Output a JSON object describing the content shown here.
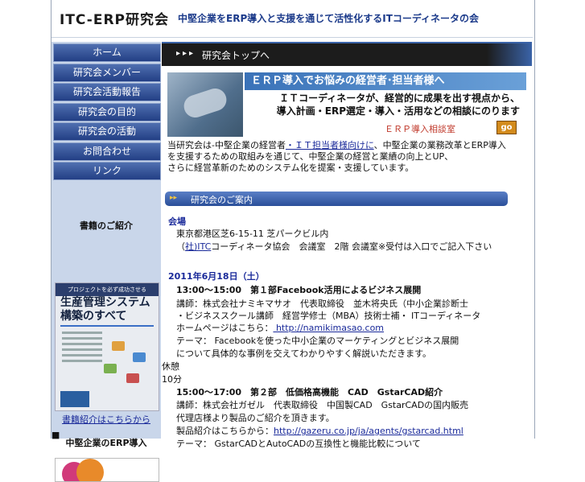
{
  "header": {
    "logo": "ITC-ERP研究会",
    "tagline": "中堅企業をERP導入と支援を通じて活性化するITコーディネータの会"
  },
  "sidebar": {
    "items": [
      {
        "label": "ホーム"
      },
      {
        "label": "研究会メンバー"
      },
      {
        "label": "研究会活動報告"
      },
      {
        "label": "研究会の目的"
      },
      {
        "label": "研究会の活動"
      },
      {
        "label": "お問合わせ"
      },
      {
        "label": "リンク"
      }
    ],
    "book_heading": "書籍のご紹介",
    "book_cover_top": "プロジェクトを必ず成功させる",
    "book_cover_title": "生産管理システム構築のすべて",
    "book_link": "書籍紹介はこちらから",
    "bullet": "■",
    "section2_heading": "中堅企業のERP導入"
  },
  "main": {
    "page_title": "研究会トップへ",
    "banner_headline": "ＥＲＰ導入でお悩みの経営者･担当者様へ",
    "banner_message_1": "ＩＴコーディネータが、経営的に成果を出す視点から、",
    "banner_message_2": "導入計画・ERP選定・導入・活用などの相談にのります",
    "banner_link": "ＥＲＰ導入相談室",
    "go_label": "go",
    "intro_1a": "当研究会は‐中堅企業の経営者",
    "intro_1_link": "・ＩＴ担当者様向けに",
    "intro_1b": "、中堅企業の業務改革とERP導入",
    "intro_2": "を支援するための取組みを通じて、中堅企業の経営と業績の向上とUP、",
    "intro_3": "さらに経営革新のためのシステム化を提案・支援しています。",
    "news_title": "研究会のご案内",
    "arrows": "▸▸▸",
    "news_icon": "▸▸"
  },
  "events": {
    "place_label": "会場",
    "place_address": "東京都港区芝6-15-11 芝パークビル内",
    "place_org_prefix": "（",
    "place_org_link": "社)ITC",
    "place_org_rest": "コーディネータ協会　会議室　2階 会議室※受付は入口でご記入下さい",
    "date": "2011年6月18日（土）",
    "s1_time": "13:00～15:00　第１部Facebook活用によるビジネス展開",
    "s1_l1": "講師：株式会社ナミキマサオ　代表取締役　並木将央氏（中小企業診断士",
    "s1_l2": "・ビジネススクール講師　経営学修士（MBA）技術士補・ ITコーディネータ",
    "s1_l3a": "ホームページはこちら：",
    "s1_l3_link": " http://namikimasao.com ",
    "s1_l4": "テーマ： Facebookを使った中小企業のマーケティングとビジネス展開",
    "s1_l5": "について具体的な事例を交えてわかりやすく解説いただきます。",
    "break1": "休憩",
    "break2": "10分",
    "s2_time": "15:00～17:00　第２部　低価格高機能　CAD　GstarCAD紹介",
    "s2_l1": "講師：株式会社ガゼル　代表取締役　中国製CAD　GstarCADの国内販売",
    "s2_l2": "代理店様より製品のご紹介を頂きます。 ",
    "s2_l3a": "製品紹介はこちらから：",
    "s2_l3_link": "http://gazeru.co.jp/ja/agents/gstarcad.html ",
    "s2_l4": "テーマ： GstarCADとAutoCADの互換性と機能比較について"
  }
}
